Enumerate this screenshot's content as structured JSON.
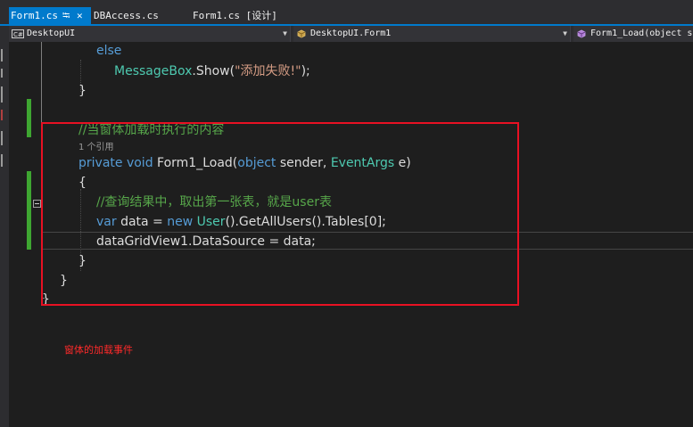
{
  "tabs": [
    {
      "label": "Form1.cs",
      "active": true
    },
    {
      "label": "DBAccess.cs",
      "active": false
    },
    {
      "label": "Form1.cs [设计]",
      "active": false
    }
  ],
  "tab_icons": {
    "pin": "pin-icon",
    "close": "close-icon"
  },
  "nav": {
    "project": "DesktopUI",
    "type": "DesktopUI.Form1",
    "member": "Form1_Load(object s"
  },
  "code": {
    "else": "else",
    "msgbox_type": "MessageBox",
    "msgbox_method": ".Show(",
    "msgbox_string": "\"添加失败!\"",
    "msgbox_end": ");",
    "brace_close_1": "}",
    "comment_load": "//当窗体加载时执行的内容",
    "ref_count": "1 个引用",
    "kw_private": "private",
    "kw_void": "void",
    "method_name": " Form1_Load(",
    "kw_object": "object",
    "param_sender": " sender, ",
    "type_eventargs": "EventArgs",
    "param_e": " e)",
    "brace_open": "{",
    "comment_query": "//查询结果中，取出第一张表，就是user表",
    "kw_var": "var",
    "var_assign": " data = ",
    "kw_new": "new",
    "type_user": "User",
    "call_chain": "().GetAllUsers().Tables[0];",
    "datasource_line": "dataGridView1.DataSource = data;",
    "brace_close_2": "}",
    "brace_close_3": "}",
    "brace_close_4": "}"
  },
  "annotation": "窗体的加载事件",
  "colors": {
    "background": "#1e1e1e",
    "keyword": "#569cd6",
    "type": "#4ec9b0",
    "string": "#d69d85",
    "comment": "#57a64a",
    "highlight": "#e81123",
    "annotation": "#ff2a2a",
    "active_tab": "#007acc"
  }
}
